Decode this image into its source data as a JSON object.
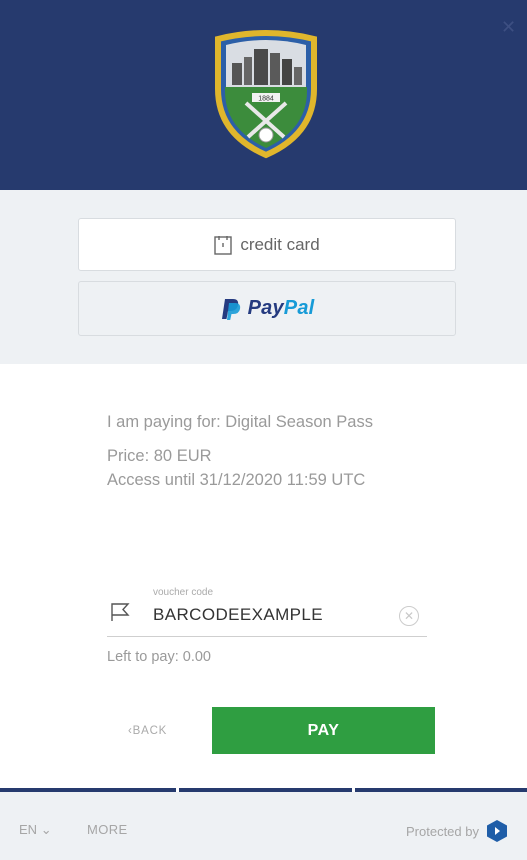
{
  "header": {
    "crest_text": "1884",
    "colors": {
      "background": "#263a6e",
      "crest_blue": "#2c5fa8",
      "crest_gold": "#e0b62c",
      "crest_green": "#3c8c3c"
    }
  },
  "payment_methods": {
    "credit_card_label": "credit card",
    "paypal_pay": "Pay",
    "paypal_pal": "Pal"
  },
  "order": {
    "paying_for": "I am paying for: Digital Season Pass",
    "price": "Price: 80 EUR",
    "access": "Access until 31/12/2020 11:59 UTC"
  },
  "voucher": {
    "label": "voucher code",
    "value": "BARCODEEXAMPLE"
  },
  "left_to_pay": "Left to pay: 0.00",
  "actions": {
    "back_label": "BACK",
    "pay_label": "PAY",
    "pay_color": "#2f9e41"
  },
  "footer": {
    "language": "EN",
    "more_label": "MORE",
    "protected_label": "Protected by"
  }
}
